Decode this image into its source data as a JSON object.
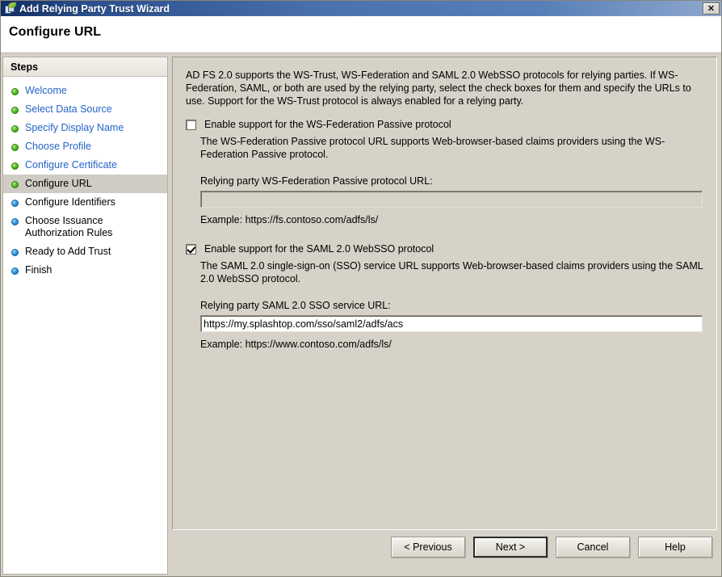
{
  "window": {
    "title": "Add Relying Party Trust Wizard",
    "icon": "wizard-icon",
    "close_label": "✕"
  },
  "header": {
    "page_title": "Configure URL"
  },
  "sidebar": {
    "header": "Steps",
    "items": [
      {
        "label": "Welcome",
        "state": "done"
      },
      {
        "label": "Select Data Source",
        "state": "done"
      },
      {
        "label": "Specify Display Name",
        "state": "done"
      },
      {
        "label": "Choose Profile",
        "state": "done"
      },
      {
        "label": "Configure Certificate",
        "state": "done"
      },
      {
        "label": "Configure URL",
        "state": "current"
      },
      {
        "label": "Configure Identifiers",
        "state": "todo"
      },
      {
        "label": "Choose Issuance Authorization Rules",
        "state": "todo"
      },
      {
        "label": "Ready to Add Trust",
        "state": "todo"
      },
      {
        "label": "Finish",
        "state": "todo"
      }
    ]
  },
  "content": {
    "intro": "AD FS 2.0 supports the WS-Trust, WS-Federation and SAML 2.0 WebSSO protocols for relying parties.  If WS-Federation, SAML, or both are used by the relying party, select the check boxes for them and specify the URLs to use.  Support for the WS-Trust protocol is always enabled for a relying party.",
    "wsfed": {
      "checkbox_label": "Enable support for the WS-Federation Passive protocol",
      "checked": false,
      "description": "The WS-Federation Passive protocol URL supports Web-browser-based claims providers using the WS-Federation Passive protocol.",
      "field_label": "Relying party WS-Federation Passive protocol URL:",
      "value": "",
      "example": "Example: https://fs.contoso.com/adfs/ls/"
    },
    "saml": {
      "checkbox_label": "Enable support for the SAML 2.0 WebSSO protocol",
      "checked": true,
      "description": "The SAML 2.0 single-sign-on (SSO) service URL supports Web-browser-based claims providers using the SAML 2.0 WebSSO protocol.",
      "field_label": "Relying party SAML 2.0 SSO service URL:",
      "value": "https://my.splashtop.com/sso/saml2/adfs/acs",
      "example": "Example: https://www.contoso.com/adfs/ls/"
    }
  },
  "footer": {
    "previous": "< Previous",
    "next": "Next >",
    "cancel": "Cancel",
    "help": "Help"
  },
  "colors": {
    "title_bar_start": "#0f2e63",
    "title_bar_end": "#8fa9cd",
    "dialog_face": "#d6d2c8",
    "step_link": "#2563c8",
    "step_done_bullet": "#53c021",
    "step_todo_bullet": "#2e97e8",
    "current_step_row": "#cfccc4"
  }
}
